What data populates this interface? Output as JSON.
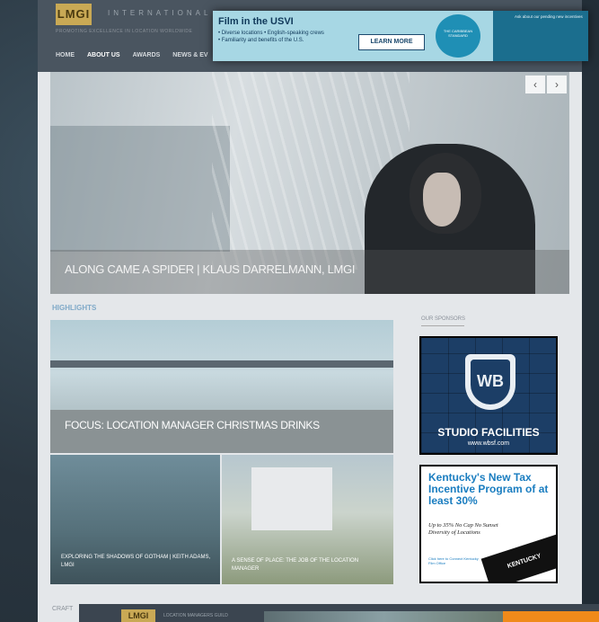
{
  "site": {
    "logo": "LMGI",
    "subtitle": "INTERNATIONAL",
    "tagline": "PROMOTING EXCELLENCE IN LOCATION WORLDWIDE"
  },
  "nav": [
    "HOME",
    "ABOUT US",
    "AWARDS",
    "NEWS & EV"
  ],
  "top_ad": {
    "title": "Film in the USVI",
    "bullets": [
      "• Diverse locations • English-speaking crews",
      "• Familiarity and benefits of the U.S."
    ],
    "cta": "LEARN MORE",
    "badge": "THE CARIBBEAN STANDARD",
    "side_text": "Ask about our pending new incentives"
  },
  "hero": {
    "caption": "ALONG CAME A SPIDER | KLAUS DARRELMANN, LMGI",
    "prev": "‹",
    "next": "›"
  },
  "highlights": {
    "heading": "HIGHLIGHTS",
    "items": [
      {
        "caption": "FOCUS: LOCATION MANAGER CHRISTMAS DRINKS"
      },
      {
        "caption": "EXPLORING THE SHADOWS OF GOTHAM | KEITH ADAMS, LMGI"
      },
      {
        "caption": "A SENSE OF PLACE: THE JOB OF THE LOCATION MANAGER"
      }
    ]
  },
  "sponsors": {
    "heading": "OUR SPONSORS",
    "wb": {
      "mark": "WB",
      "title": "STUDIO FACILITIES",
      "url": "www.wbsf.com"
    },
    "kentucky": {
      "title": "Kentucky's New Tax Incentive Program of at least 30%",
      "sub": "Up to 35% No Cap No Sunset Diversity of Locations",
      "contact": "Click here to Connect Kentucky Film Office",
      "logo": "KENTUCKY"
    }
  },
  "footer": {
    "section": "CRAFT",
    "logo": "LMGI",
    "guild": "LOCATION MANAGERS GUILD"
  }
}
